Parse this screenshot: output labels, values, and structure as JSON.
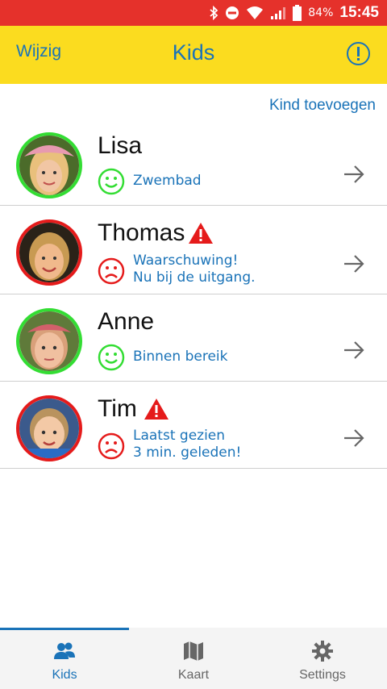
{
  "status_bar": {
    "battery_percent": "84%",
    "time": "15:45",
    "icons": [
      "bluetooth-icon",
      "do-not-disturb-icon",
      "wifi-icon",
      "signal-icon",
      "battery-icon"
    ]
  },
  "header": {
    "edit_label": "Wijzig",
    "title": "Kids",
    "info_icon": "info-icon"
  },
  "add_kid_label": "Kind toevoegen",
  "kids": [
    {
      "name": "Lisa",
      "status_line1": "Zwembad",
      "status_line2": "",
      "mood": "happy",
      "warning": false
    },
    {
      "name": "Thomas",
      "status_line1": "Waarschuwing!",
      "status_line2": "Nu bij de uitgang.",
      "mood": "sad",
      "warning": true
    },
    {
      "name": "Anne",
      "status_line1": "Binnen bereik",
      "status_line2": "",
      "mood": "happy",
      "warning": false
    },
    {
      "name": "Tim",
      "status_line1": "Laatst gezien",
      "status_line2": "3 min. geleden!",
      "mood": "sad",
      "warning": true
    }
  ],
  "tabs": [
    {
      "label": "Kids",
      "icon": "kids-icon",
      "active": true
    },
    {
      "label": "Kaart",
      "icon": "map-icon",
      "active": false
    },
    {
      "label": "Settings",
      "icon": "gear-icon",
      "active": false
    }
  ],
  "colors": {
    "status_bar": "#e5312b",
    "header": "#fbdc1f",
    "accent_blue": "#1a73b8",
    "ok_green": "#33dd33",
    "alert_red": "#e51b1b"
  }
}
